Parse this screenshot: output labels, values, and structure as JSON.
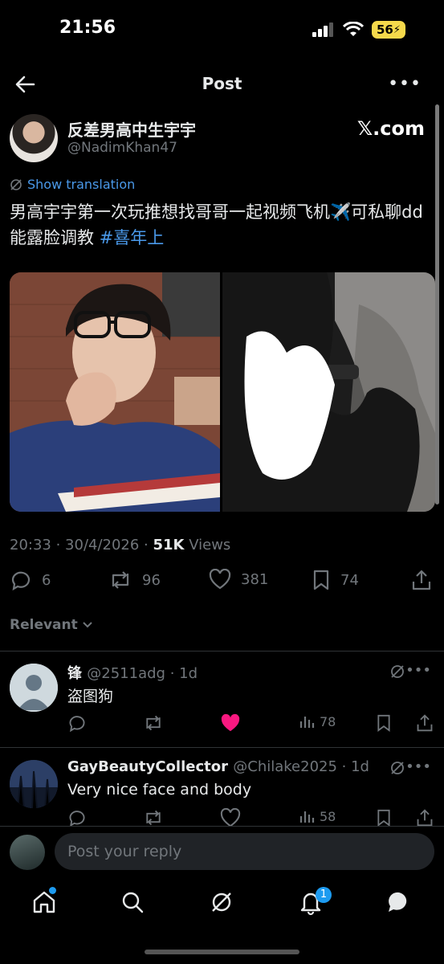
{
  "status_bar": {
    "time": "21:56",
    "battery": "56"
  },
  "nav": {
    "title": "Post"
  },
  "post": {
    "author_name": "反差男高中生宇宇",
    "author_handle": "@NadimKhan47",
    "watermark": "𝕏.com",
    "translate_label": "Show translation",
    "text": "男高宇宇第一次玩推想找哥哥一起视频飞机✈️可私聊dd能露脸调教 ",
    "hashtag": "#喜年上",
    "timestamp": "20:33 · 30/4/2026 · ",
    "views_count": "51K",
    "views_label": " Views",
    "replies": "6",
    "reposts": "96",
    "likes": "381",
    "bookmarks": "74"
  },
  "filter": {
    "label": "Relevant"
  },
  "replies": [
    {
      "name": "锋",
      "handle": "@2511adg · 1d",
      "text": "盗图狗",
      "views": "78"
    },
    {
      "name": "GayBeautyCollector",
      "handle": "@Chilake2025 · 1d",
      "text": "Very nice face and body",
      "views": "58"
    }
  ],
  "compose": {
    "placeholder": "Post your reply"
  },
  "tabbar": {
    "notifications_badge": "1"
  },
  "colors": {
    "accent": "#1d9bf0",
    "link": "#4a99e9",
    "like": "#f91880",
    "muted": "#71767b"
  }
}
